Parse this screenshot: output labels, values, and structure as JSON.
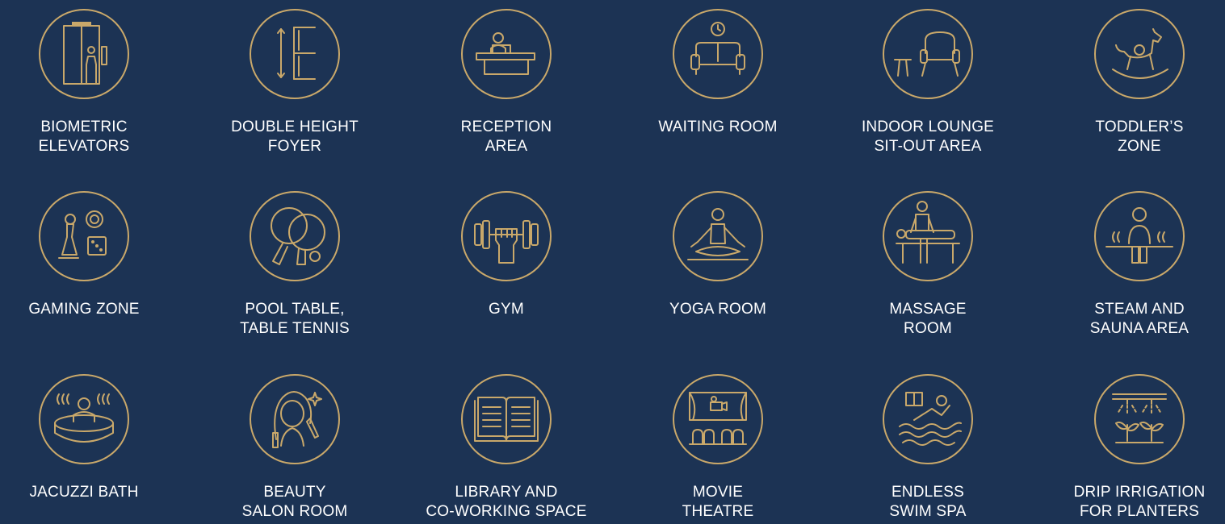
{
  "colors": {
    "background": "#1c3354",
    "icon_gold": "#c9a86a",
    "label_text": "#ffffff"
  },
  "amenities": [
    {
      "icon": "biometric-elevator-icon",
      "line1": "BIOMETRIC",
      "line2": "ELEVATORS"
    },
    {
      "icon": "double-height-foyer-icon",
      "line1": "DOUBLE HEIGHT",
      "line2": "FOYER"
    },
    {
      "icon": "reception-desk-icon",
      "line1": "RECEPTION",
      "line2": "AREA"
    },
    {
      "icon": "waiting-sofa-icon",
      "line1": "WAITING ROOM",
      "line2": ""
    },
    {
      "icon": "lounge-armchair-icon",
      "line1": "INDOOR LOUNGE",
      "line2": "SIT-OUT AREA"
    },
    {
      "icon": "rocking-horse-icon",
      "line1": "TODDLER’S",
      "line2": "ZONE"
    },
    {
      "icon": "gaming-pieces-icon",
      "line1": "GAMING ZONE",
      "line2": ""
    },
    {
      "icon": "table-tennis-paddle-icon",
      "line1": "POOL TABLE,",
      "line2": "TABLE TENNIS"
    },
    {
      "icon": "dumbbell-icon",
      "line1": "GYM",
      "line2": ""
    },
    {
      "icon": "yoga-pose-icon",
      "line1": "YOGA ROOM",
      "line2": ""
    },
    {
      "icon": "massage-table-icon",
      "line1": "MASSAGE",
      "line2": "ROOM"
    },
    {
      "icon": "sauna-person-icon",
      "line1": "STEAM AND",
      "line2": "SAUNA AREA"
    },
    {
      "icon": "jacuzzi-icon",
      "line1": "JACUZZI BATH",
      "line2": ""
    },
    {
      "icon": "beauty-salon-icon",
      "line1": "BEAUTY",
      "line2": "SALON ROOM"
    },
    {
      "icon": "open-book-icon",
      "line1": "LIBRARY AND",
      "line2": "CO-WORKING SPACE"
    },
    {
      "icon": "movie-theatre-icon",
      "line1": "MOVIE",
      "line2": "THEATRE"
    },
    {
      "icon": "swimmer-icon",
      "line1": "ENDLESS",
      "line2": "SWIM SPA"
    },
    {
      "icon": "drip-irrigation-icon",
      "line1": "DRIP IRRIGATION",
      "line2": "FOR PLANTERS"
    }
  ]
}
